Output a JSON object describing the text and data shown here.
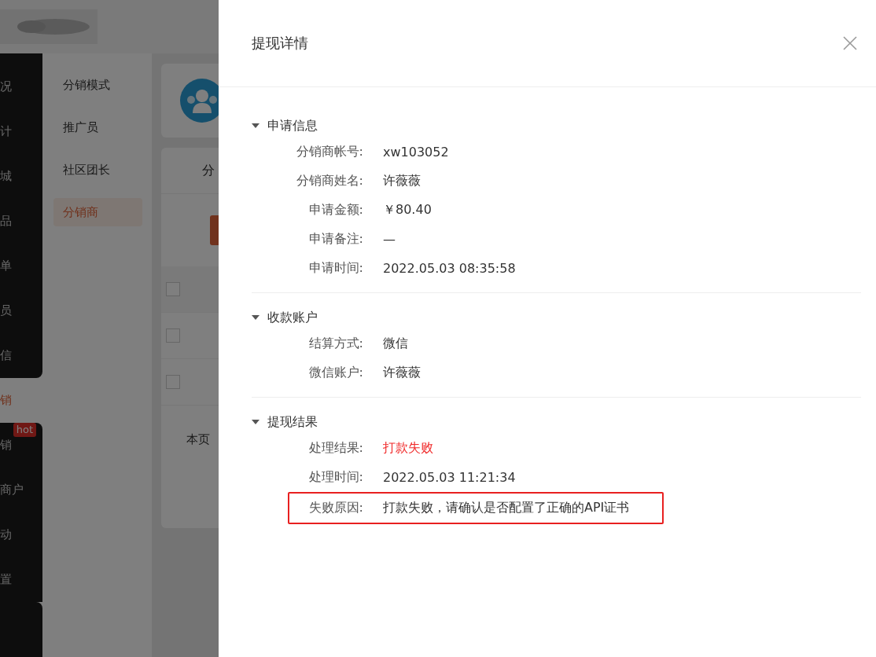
{
  "nav": [
    {
      "label": "况",
      "selected": false
    },
    {
      "label": "计",
      "selected": false
    },
    {
      "label": "城",
      "selected": false
    },
    {
      "label": "品",
      "selected": false
    },
    {
      "label": "单",
      "selected": false
    },
    {
      "label": "员",
      "selected": false
    },
    {
      "label": "信",
      "selected": false
    },
    {
      "label": "销",
      "selected": true
    },
    {
      "label": "销",
      "selected": false,
      "badge": "hot"
    },
    {
      "label": "商户",
      "selected": false
    },
    {
      "label": "动",
      "selected": false
    },
    {
      "label": "置",
      "selected": false
    }
  ],
  "subnav": [
    {
      "label": "分销模式",
      "selected": false
    },
    {
      "label": "推广员",
      "selected": false
    },
    {
      "label": "社区团长",
      "selected": false
    },
    {
      "label": "分销商",
      "selected": true
    }
  ],
  "main": {
    "tab": "分",
    "footer": "本页",
    "rows": [
      {
        "checked": false
      },
      {
        "checked": false
      },
      {
        "checked": false
      }
    ]
  },
  "drawer": {
    "title": "提现详情",
    "sections": [
      {
        "title": "申请信息",
        "expanded": true,
        "fields": [
          {
            "label": "分销商帐号:",
            "value": "xw103052",
            "kind": "text",
            "highlighted": false
          },
          {
            "label": "分销商姓名:",
            "value": "许薇薇",
            "kind": "text",
            "highlighted": false
          },
          {
            "label": "申请金额:",
            "value": "￥80.40",
            "kind": "text",
            "highlighted": false
          },
          {
            "label": "申请备注:",
            "value": "—",
            "kind": "text",
            "highlighted": false
          },
          {
            "label": "申请时间:",
            "value": "2022.05.03 08:35:58",
            "kind": "text",
            "highlighted": false
          }
        ]
      },
      {
        "title": "收款账户",
        "expanded": true,
        "fields": [
          {
            "label": "结算方式:",
            "value": "微信",
            "kind": "text",
            "highlighted": false
          },
          {
            "label": "微信账户:",
            "value": "许薇薇",
            "kind": "text",
            "highlighted": false
          }
        ]
      },
      {
        "title": "提现结果",
        "expanded": true,
        "fields": [
          {
            "label": "处理结果:",
            "value": "打款失败",
            "kind": "error",
            "highlighted": false
          },
          {
            "label": "处理时间:",
            "value": "2022.05.03 11:21:34",
            "kind": "text",
            "highlighted": false
          },
          {
            "label": "失败原因:",
            "value": "打款失败，请确认是否配置了正确的API证书",
            "kind": "text",
            "highlighted": true
          }
        ]
      }
    ]
  }
}
